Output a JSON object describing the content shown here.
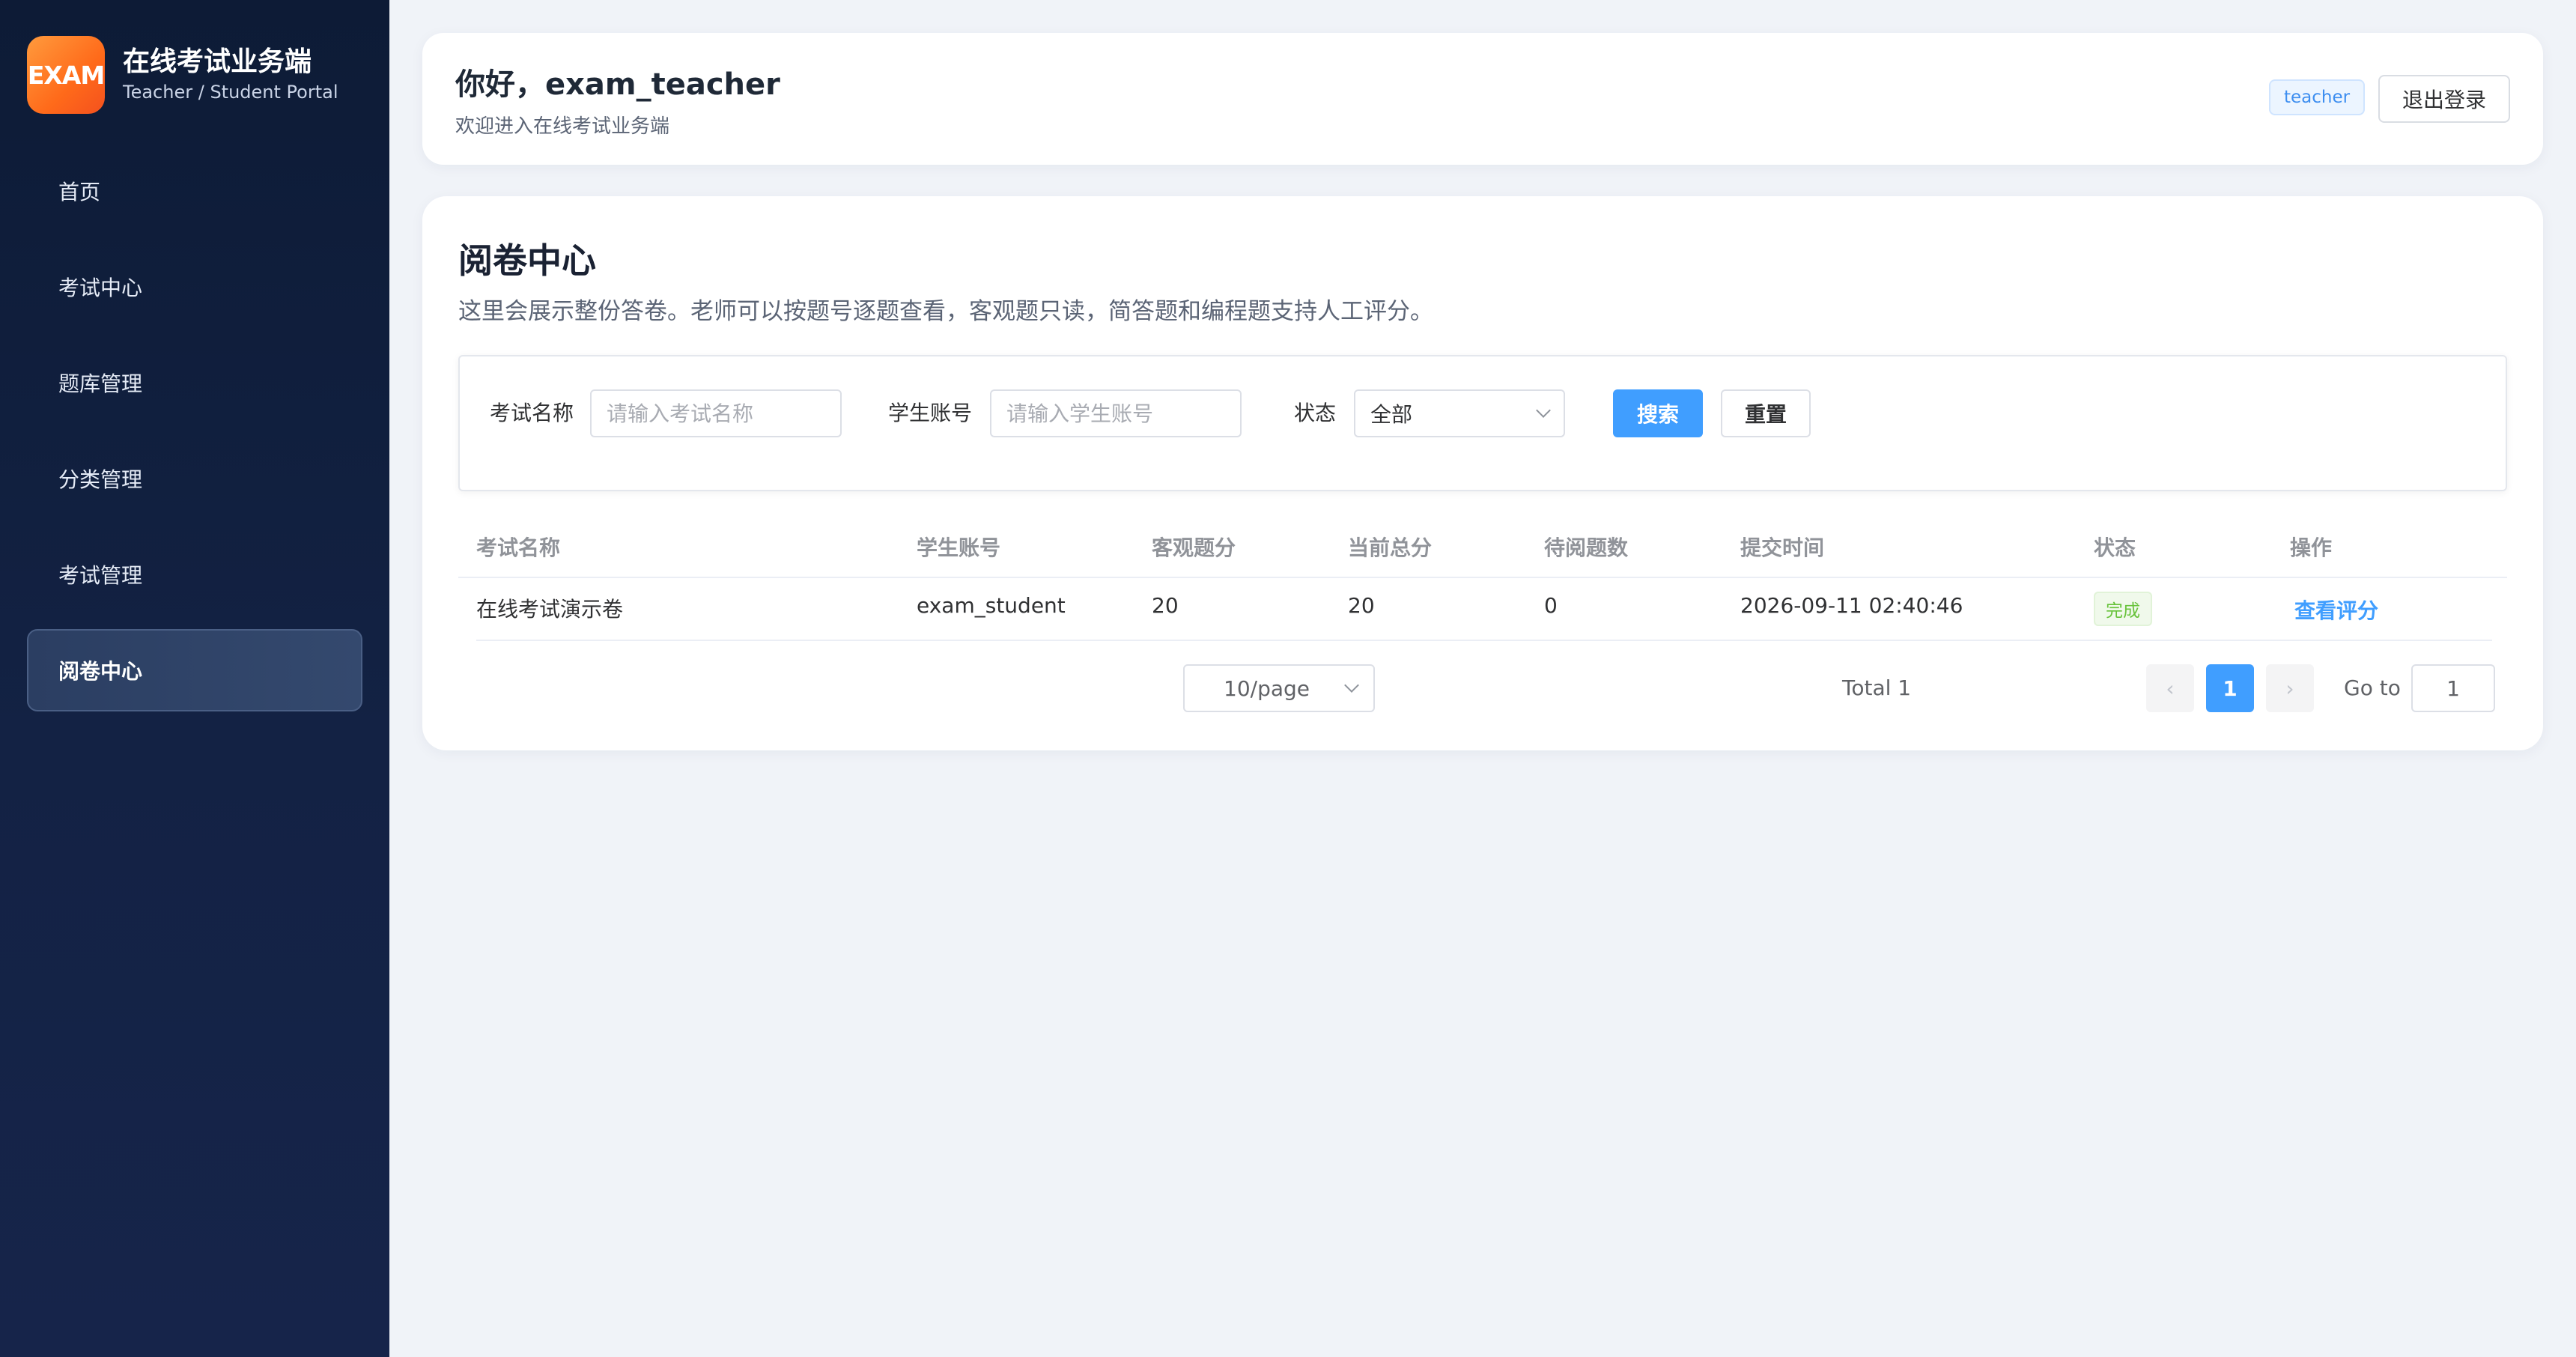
{
  "brand": {
    "logo_text": "EXAM",
    "title": "在线考试业务端",
    "subtitle": "Teacher / Student Portal"
  },
  "sidebar": {
    "items": [
      {
        "label": "首页",
        "active": false
      },
      {
        "label": "考试中心",
        "active": false
      },
      {
        "label": "题库管理",
        "active": false
      },
      {
        "label": "分类管理",
        "active": false
      },
      {
        "label": "考试管理",
        "active": false
      },
      {
        "label": "阅卷中心",
        "active": true
      }
    ]
  },
  "header": {
    "greeting": "你好，exam_teacher",
    "welcome": "欢迎进入在线考试业务端",
    "role_tag": "teacher",
    "logout_label": "退出登录"
  },
  "main": {
    "title": "阅卷中心",
    "description": "这里会展示整份答卷。老师可以按题号逐题查看，客观题只读，简答题和编程题支持人工评分。"
  },
  "filters": {
    "exam_name_label": "考试名称",
    "exam_name_placeholder": "请输入考试名称",
    "exam_name_value": "",
    "student_label": "学生账号",
    "student_placeholder": "请输入学生账号",
    "student_value": "",
    "status_label": "状态",
    "status_value": "全部",
    "search_label": "搜索",
    "reset_label": "重置"
  },
  "table": {
    "columns": [
      "考试名称",
      "学生账号",
      "客观题分",
      "当前总分",
      "待阅题数",
      "提交时间",
      "状态",
      "操作"
    ],
    "rows": [
      {
        "exam_name": "在线考试演示卷",
        "student": "exam_student",
        "objective_score": "20",
        "total_score": "20",
        "pending_count": "0",
        "submit_time": "2026-09-11 02:40:46",
        "status": "完成",
        "action": "查看评分"
      }
    ]
  },
  "pagination": {
    "total_text": "Total 1",
    "page_size": "10/page",
    "prev_icon": "‹",
    "next_icon": "›",
    "current_page": "1",
    "goto_label": "Go to",
    "goto_value": "1"
  },
  "colors": {
    "sidebar_bg": "#0d1b36",
    "accent": "#409eff",
    "logo_orange": "#ff6a1a",
    "success": "#67c23a"
  }
}
